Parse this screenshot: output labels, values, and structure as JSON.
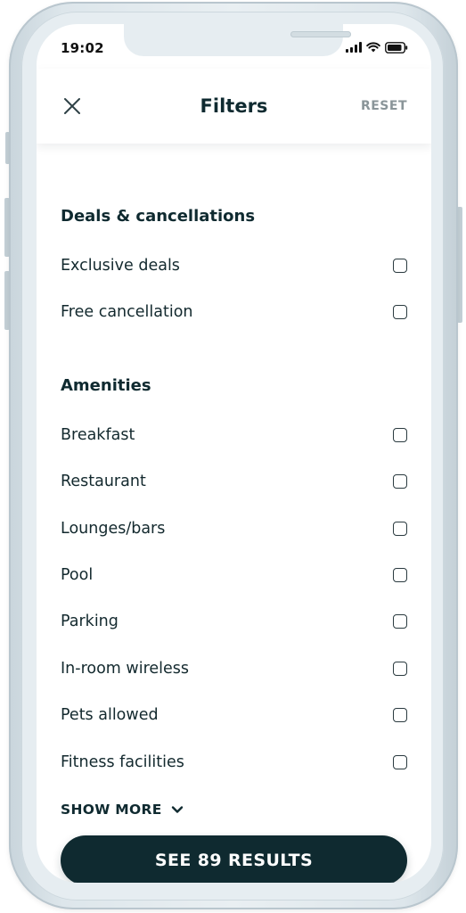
{
  "status_bar": {
    "time": "19:02"
  },
  "header": {
    "title": "Filters",
    "reset_label": "RESET"
  },
  "sections": {
    "deals": {
      "title": "Deals & cancellations",
      "items": [
        {
          "label": "Exclusive deals",
          "checked": false
        },
        {
          "label": "Free cancellation",
          "checked": false
        }
      ]
    },
    "amenities": {
      "title": "Amenities",
      "items": [
        {
          "label": "Breakfast",
          "checked": false
        },
        {
          "label": "Restaurant",
          "checked": false
        },
        {
          "label": "Lounges/bars",
          "checked": false
        },
        {
          "label": "Pool",
          "checked": false
        },
        {
          "label": "Parking",
          "checked": false
        },
        {
          "label": "In-room wireless",
          "checked": false
        },
        {
          "label": "Pets allowed",
          "checked": false
        },
        {
          "label": "Fitness facilities",
          "checked": false
        }
      ]
    }
  },
  "show_more_label": "SHOW MORE",
  "results_button_label": "SEE 89 RESULTS",
  "icons": {
    "close": "close-icon",
    "chevron": "chevron-down-icon",
    "signal": "signal-icon",
    "wifi": "wifi-icon",
    "battery": "battery-icon"
  },
  "colors": {
    "primary_dark": "#0f2a30",
    "muted_text": "#8a9599",
    "device_frame": "#e6edf1"
  }
}
